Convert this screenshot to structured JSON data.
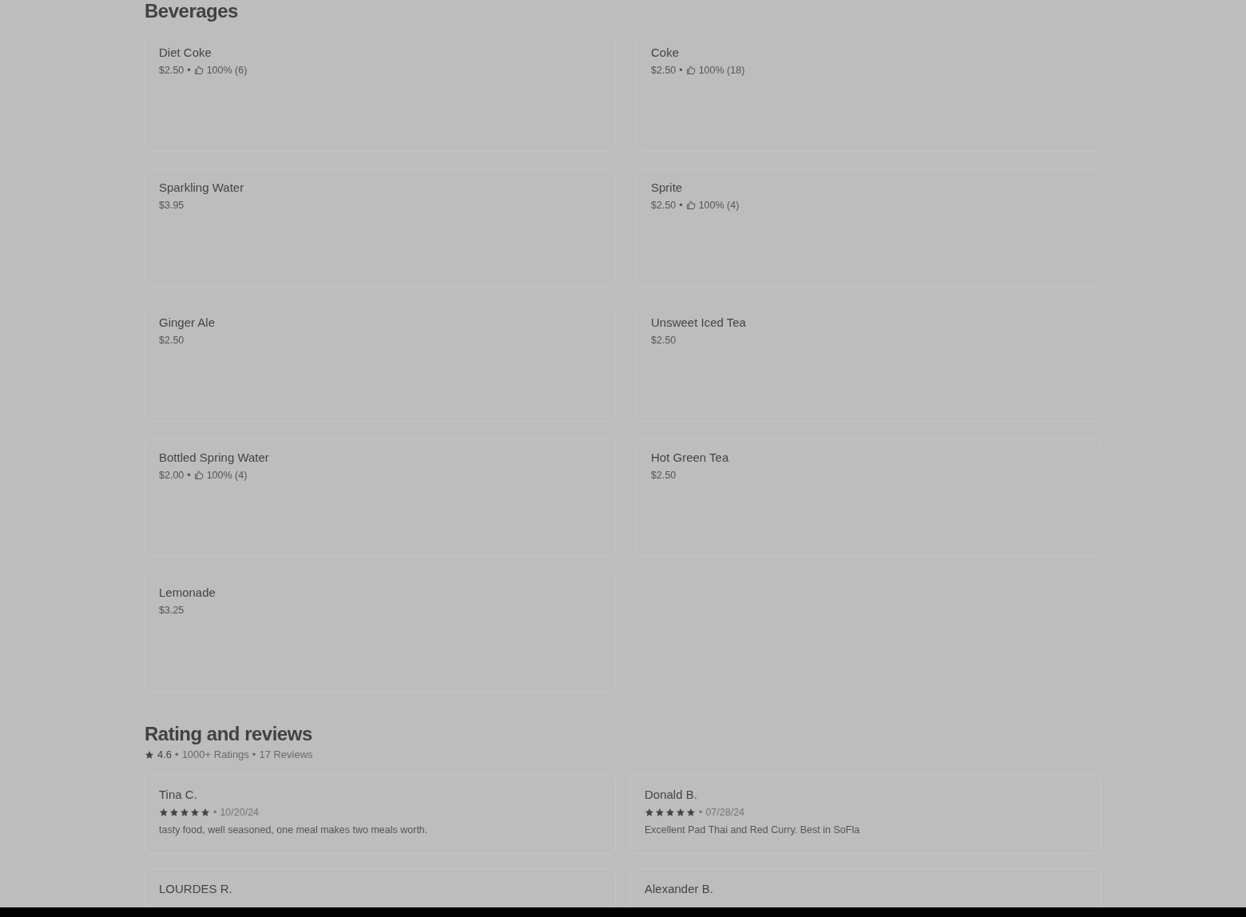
{
  "menu_section": {
    "title": "Beverages",
    "items": [
      {
        "name": "Diet Coke",
        "price": "$2.50",
        "separator": "•",
        "rating": "100% (6)"
      },
      {
        "name": "Coke",
        "price": "$2.50",
        "separator": "•",
        "rating": "100% (18)"
      },
      {
        "name": "Sparkling Water",
        "price": "$3.95"
      },
      {
        "name": "Sprite",
        "price": "$2.50",
        "separator": "•",
        "rating": "100% (4)"
      },
      {
        "name": "Ginger Ale",
        "price": "$2.50"
      },
      {
        "name": "Unsweet Iced Tea",
        "price": "$2.50"
      },
      {
        "name": "Bottled Spring Water",
        "price": "$2.00",
        "separator": "•",
        "rating": "100% (4)"
      },
      {
        "name": "Hot Green Tea",
        "price": "$2.50"
      },
      {
        "name": "Lemonade",
        "price": "$3.25"
      }
    ]
  },
  "reviews_section": {
    "title": "Rating and reviews",
    "score": "4.6",
    "separator_1": "•",
    "ratings": "1000+ Ratings",
    "separator_2": "•",
    "reviews_count": "17 Reviews",
    "reviews": [
      {
        "name": "Tina C.",
        "stars": 5,
        "separator": "•",
        "date": "10/20/24",
        "text": "tasty food, well seasoned, one meal makes two meals worth."
      },
      {
        "name": "Donald B.",
        "stars": 5,
        "separator": "•",
        "date": "07/28/24",
        "text": "Excellent Pad Thai and Red Curry. Best in SoFla"
      },
      {
        "name": "LOURDES R."
      },
      {
        "name": "Alexander B."
      }
    ]
  }
}
